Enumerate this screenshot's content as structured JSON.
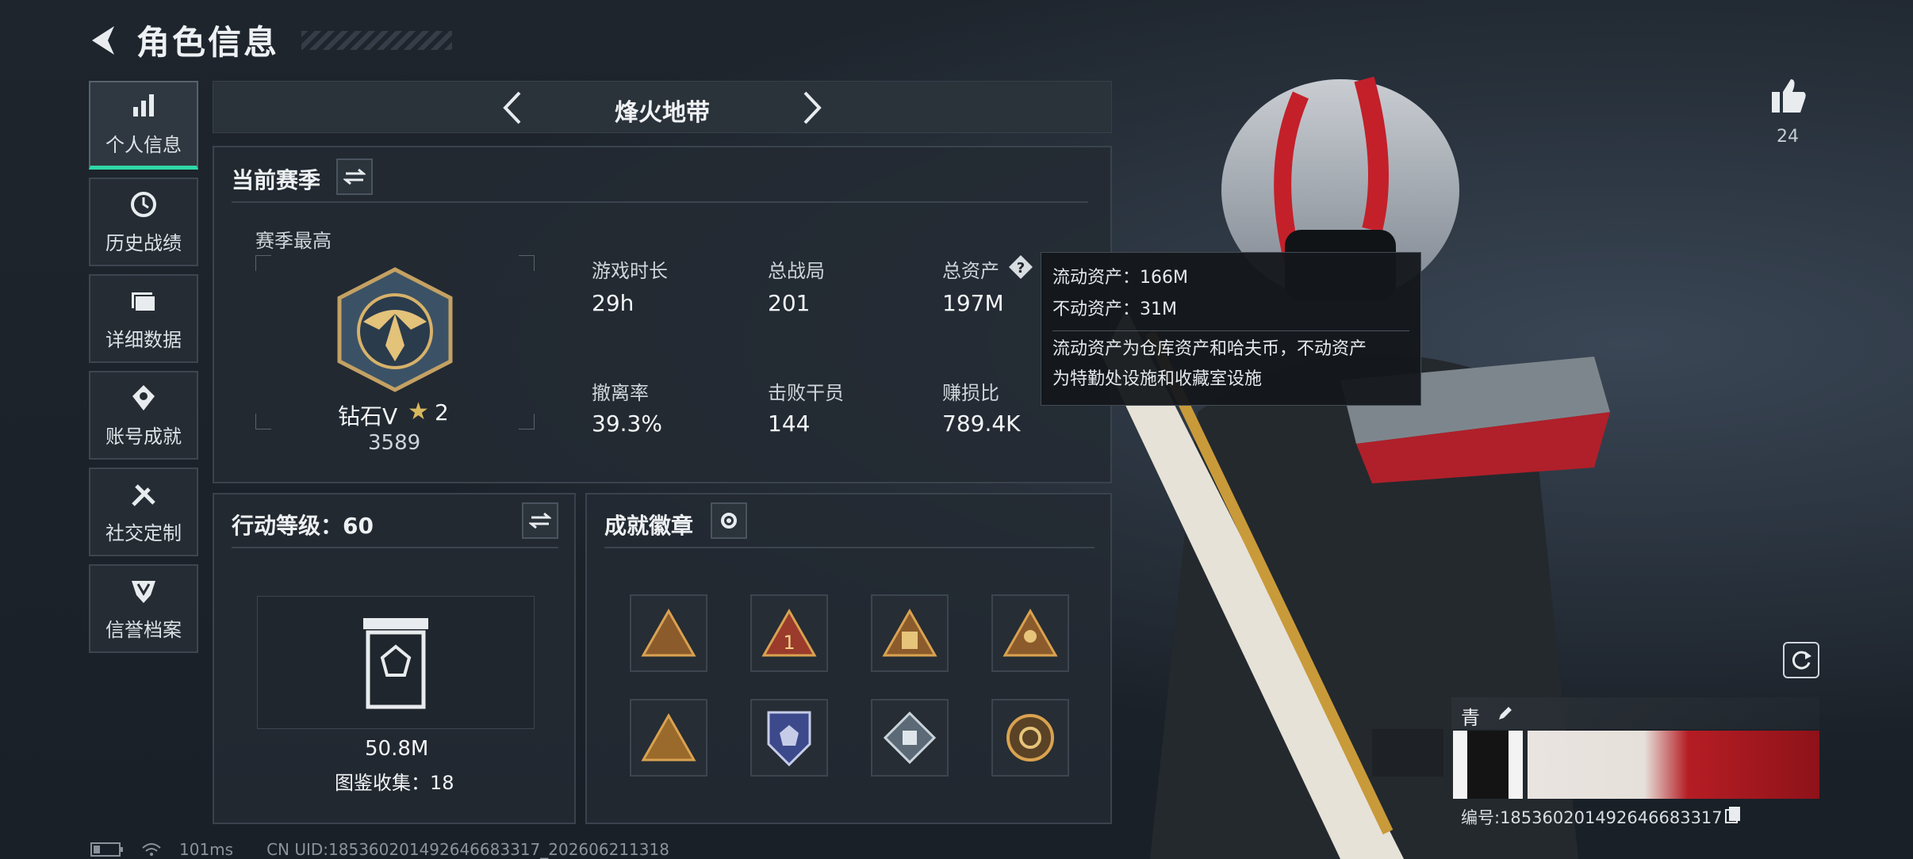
{
  "header": {
    "title": "角色信息"
  },
  "sidebar": {
    "items": [
      {
        "label": "个人信息",
        "icon": "bar-chart-icon",
        "active": true
      },
      {
        "label": "历史战绩",
        "icon": "history-icon"
      },
      {
        "label": "详细数据",
        "icon": "folder-icon"
      },
      {
        "label": "账号成就",
        "icon": "achievement-icon"
      },
      {
        "label": "社交定制",
        "icon": "tools-icon"
      },
      {
        "label": "信誉档案",
        "icon": "shield-icon"
      }
    ]
  },
  "mode_nav": {
    "title": "烽火地带"
  },
  "season": {
    "title": "当前赛季",
    "best_label": "赛季最高",
    "rank_name": "钻石V",
    "rank_stars": "2",
    "rank_points": "3589",
    "stats": [
      {
        "label": "游戏时长",
        "value": "29h"
      },
      {
        "label": "总战局",
        "value": "201"
      },
      {
        "label": "总资产",
        "value": "197M"
      },
      {
        "label": "撤离率",
        "value": "39.3%"
      },
      {
        "label": "击败干员",
        "value": "144"
      },
      {
        "label": "赚损比",
        "value": "789.4K"
      }
    ]
  },
  "tooltip": {
    "line1": "流动资产：166M",
    "line2": "不动资产：31M",
    "desc1": "流动资产为仓库资产和哈夫币，不动资产",
    "desc2": "为特勤处设施和收藏室设施"
  },
  "action_level": {
    "title": "行动等级：60",
    "value": "50.8M",
    "collection": "图鉴收集：18"
  },
  "badges": {
    "title": "成就徽章"
  },
  "likes": {
    "count": "24"
  },
  "profile_card": {
    "name": "青",
    "id_text": "编号:185360201492646683317"
  },
  "status": {
    "ping": "101ms",
    "uid": "CN UID:185360201492646683317_202606211318"
  },
  "colors": {
    "accent": "#2fd8a6",
    "panel_border": "#3a434d",
    "background": "#1b2128"
  }
}
